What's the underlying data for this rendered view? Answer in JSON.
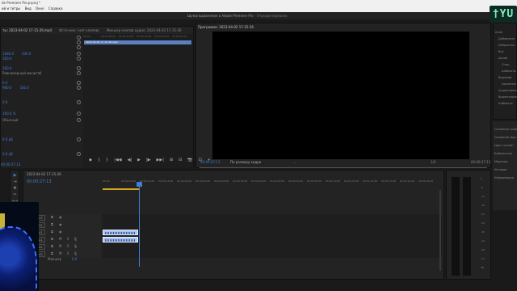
{
  "window": {
    "title": "de Premiere Pro.prproj *"
  },
  "menu": [
    "ий и титры",
    "Вид",
    "Окно",
    "Справка"
  ],
  "workspace": {
    "title": "Шумоподавление в Adobe Premiere Pro",
    "status": "- Отредактировано"
  },
  "badge": {
    "text": "†YU"
  },
  "effect_controls": {
    "tabs": [
      "Источник: (нет клипов)",
      "Микшер клипов аудио: 2023-04-02 17-15-26"
    ],
    "active_tab": "ты: 2023-04-02 17-15-26.mp4",
    "sequence_label": "2023-04-02 17-15-26.mp4",
    "rows": [
      {
        "text": "1080.0",
        "extra": "540.0",
        "color": "blue"
      },
      {
        "text": "100.0",
        "extra": "",
        "color": "blue"
      },
      {
        "text": "100.0",
        "extra": "",
        "color": "blue"
      },
      {
        "text": "Равномерный масштаб",
        "extra": "",
        "color": "plain"
      },
      {
        "text": "0.0",
        "extra": "",
        "color": "blue"
      },
      {
        "text": "960.0",
        "extra": "540.0",
        "color": "blue"
      },
      {
        "text": "0.0",
        "extra": "",
        "color": "blue"
      },
      {
        "text": "100.0 %",
        "extra": "",
        "color": "blue"
      },
      {
        "text": "Обычный",
        "extra": "",
        "color": "plain"
      },
      {
        "text": "0.0 дБ",
        "extra": "",
        "color": "blue"
      },
      {
        "text": "0.0 дБ",
        "extra": "",
        "color": "blue"
      }
    ],
    "ruler": [
      "00:00",
      "00:00:05:00",
      "00:00:10:00",
      "00:00:15:00",
      "00:00:20:00",
      "00:00:25:00"
    ],
    "timecode": "00:00:27:13"
  },
  "program": {
    "tab": "Программа: 2023-04-02 17-15-26",
    "timecode": "00:00:27:13",
    "fit": "По размеру кадра",
    "quality": "1/4",
    "duration": "00:00:27:13"
  },
  "transport": [
    "◆",
    "{",
    "}",
    "|◀◀",
    "◀|",
    "▶",
    "|▶",
    "▶▶|",
    "⊞",
    "⊟",
    "📷",
    "⊡",
    "+"
  ],
  "project": {
    "items": [
      "ение",
      "Добавлено",
      "Избранное",
      "Всё",
      "Архив",
      "Спец",
      "Шаблоны",
      "Видеоэф",
      "Удаление",
      "Аудиопереходы",
      "Видеопереходы",
      "Шаблоны"
    ]
  },
  "workspaces": [
    "Основная графика",
    "Основной звук",
    "Цвет Lumetri",
    "Библиотеки",
    "Маркеры",
    "История",
    "Информация"
  ],
  "tools": [
    "▶",
    "⇥",
    "✥",
    "✂",
    "⟷",
    "✎",
    "☐",
    "✋",
    "T"
  ],
  "timeline": {
    "tab": "2023-04-02 17-15-26",
    "timecode": "00:00:27:13",
    "ruler": [
      "00:00",
      "00:00:05:00",
      "00:00:10:00",
      "00:00:15:00",
      "00:00:20:00",
      "00:00:25:00",
      "00:00:30:00",
      "00:00:35:00",
      "00:00:40:00",
      "00:00:45:00",
      "00:00:50:00",
      "00:00:55:00",
      "00:01:00:00",
      "00:01:05:00",
      "00:01:10:00",
      "00:01:15:00",
      "00:01:20:00",
      "00:01:25:00"
    ],
    "tracks": [
      {
        "label": "V3",
        "type": "video",
        "clip": false
      },
      {
        "label": "V2",
        "type": "video",
        "clip": false
      },
      {
        "label": "V1",
        "type": "video",
        "clip": true
      },
      {
        "label": "A1",
        "type": "audio",
        "clip": true,
        "m": "M",
        "s": "S"
      },
      {
        "label": "A2",
        "type": "audio",
        "clip": false,
        "m": "M",
        "s": "S"
      },
      {
        "label": "A3",
        "type": "audio",
        "clip": false,
        "m": "M",
        "s": "S"
      }
    ],
    "mix_label": "Микшер",
    "mix_value": "0.0"
  },
  "meters": {
    "scale": [
      "0",
      "-6",
      "-12",
      "-18",
      "-24",
      "-30",
      "-36",
      "-42",
      "-48",
      "-54",
      "dB"
    ]
  },
  "colors": {
    "accent": "#3f7fd8",
    "work_area": "#d2a520",
    "clip": "#a9c4ef"
  }
}
